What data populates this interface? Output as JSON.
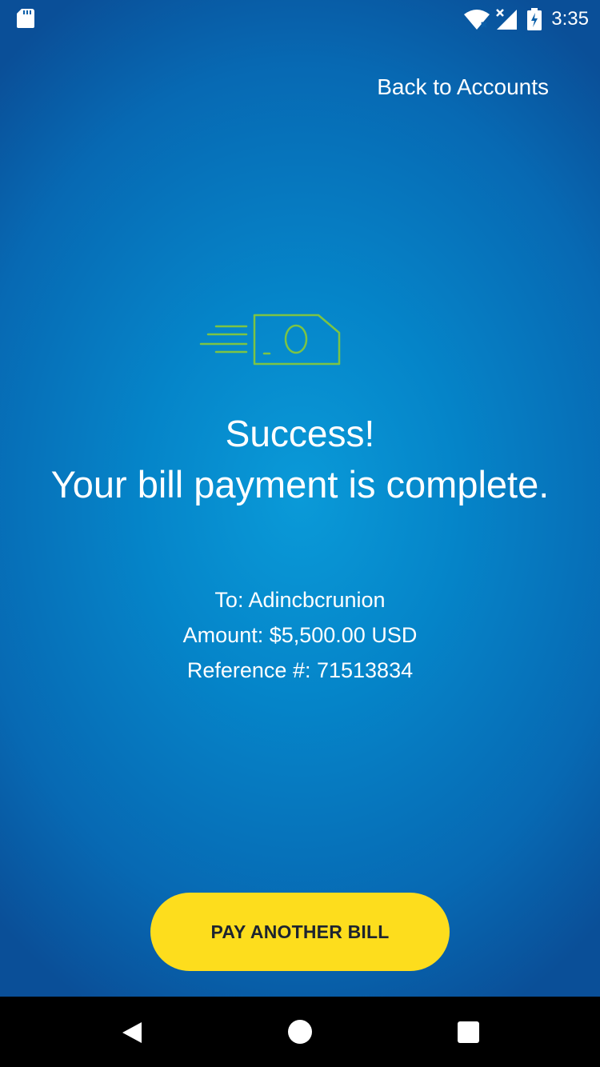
{
  "status_bar": {
    "time": "3:35",
    "icons": [
      "sd-card-icon",
      "wifi-icon",
      "signal-icon",
      "battery-charging-icon"
    ]
  },
  "header": {
    "back_link": "Back to Accounts"
  },
  "confirmation": {
    "icon": "payment-sent-icon",
    "title_line1": "Success!",
    "title_line2": "Your bill payment is complete.",
    "to": "To: Adincbcrunion",
    "amount": "Amount: $5,500.00 USD",
    "reference": "Reference #: 71513834"
  },
  "actions": {
    "pay_another": "PAY ANOTHER BILL"
  },
  "nav_bar": {
    "icons": [
      "back-triangle-icon",
      "home-circle-icon",
      "recents-square-icon"
    ]
  },
  "colors": {
    "background": "#0585c9",
    "icon_green": "#7cc444",
    "button_yellow": "#fddd1d",
    "button_text": "#1d2430"
  }
}
